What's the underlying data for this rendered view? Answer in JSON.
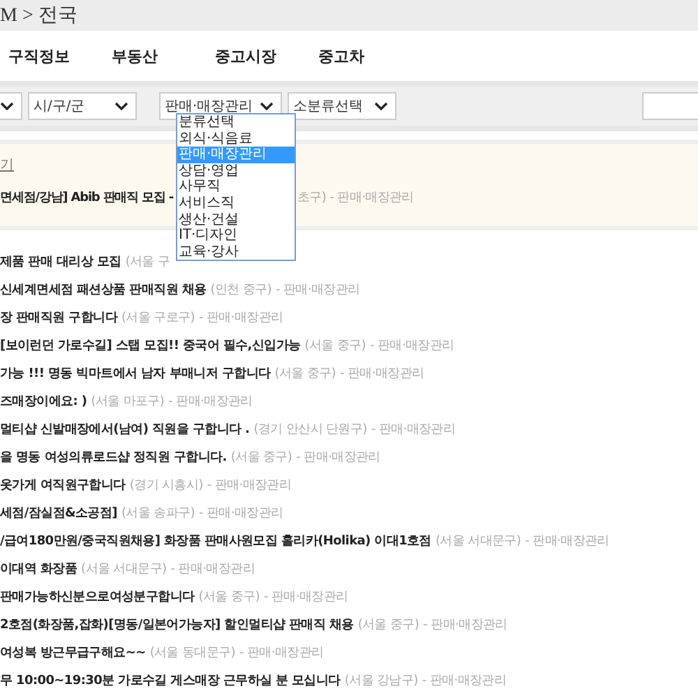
{
  "breadcrumb": "M > 전국",
  "nav": [
    "구직정보",
    "부동산",
    "중고시장",
    "중고차"
  ],
  "filters": [
    {
      "kind": "cut"
    },
    {
      "kind": "select",
      "value": "시/구/군"
    },
    {
      "kind": "select",
      "value": "판매·매장관리"
    },
    {
      "kind": "select",
      "value": "소분류선택"
    }
  ],
  "dropdown": {
    "options": [
      {
        "label": "분류선택",
        "selected": false
      },
      {
        "label": "외식·식음료",
        "selected": false
      },
      {
        "label": "판매·매장관리",
        "selected": true
      },
      {
        "label": "상담·영업",
        "selected": false
      },
      {
        "label": "사무직",
        "selected": false
      },
      {
        "label": "서비스직",
        "selected": false
      },
      {
        "label": "생산·건설",
        "selected": false
      },
      {
        "label": "IT·디자인",
        "selected": false
      },
      {
        "label": "교육·강사",
        "selected": false
      }
    ]
  },
  "featured": {
    "link": "기",
    "title": "면세점/강남] Abib 판매직 모집 -",
    "tail": "초구) - 판매·매장관리"
  },
  "posts": [
    {
      "title": "제품 판매 대리상 모집",
      "location": "(서울 구"
    },
    {
      "title": "신세계면세점 패션상품 판매직원 채용",
      "location": "(인천 중구)",
      "category": "- 판매·매장관리"
    },
    {
      "title": "장 판매직원 구합니다",
      "location": "(서울 구로구)",
      "category": "- 판매·매장관리"
    },
    {
      "title": "[보이런던 가로수길] 스탭 모집!! 중국어 필수,신입가능",
      "location": "(서울 중구)",
      "category": "- 판매·매장관리"
    },
    {
      "title": "가능 !!! 명동 빅마트에서 남자 부매니저 구합니다",
      "location": "(서울 중구)",
      "category": "- 판매·매장관리"
    },
    {
      "title": "즈매장이에요: )",
      "location": "(서울 마포구)",
      "category": "- 판매·매장관리"
    },
    {
      "title": "멀티샵 신발매장에서(남여) 직원을 구합니다 .",
      "location": "(경기 안산시 단원구)",
      "category": "- 판매·매장관리"
    },
    {
      "title": "을 명동 여성의류로드샵 정직원 구합니다.",
      "location": "(서울 중구)",
      "category": "- 판매·매장관리"
    },
    {
      "title": "옷가게 여직원구합니다",
      "location": "(경기 시흥시)",
      "category": "- 판매·매장관리"
    },
    {
      "title": "세점/잠실점&소공점]",
      "location": "(서울 송파구)",
      "category": "- 판매·매장관리"
    },
    {
      "title": "/급여180만원/중국직원채용] 화장품 판매사원모집 홀리카(Holika) 이대1호점",
      "location": "(서울 서대문구)",
      "category": "- 판매·매장관리"
    },
    {
      "title": "이대역 화장품",
      "location": "(서울 서대문구)",
      "category": "- 판매·매장관리"
    },
    {
      "title": "판매가능하신분으로여성분구합니다",
      "location": "(서울 중구)",
      "category": "- 판매·매장관리"
    },
    {
      "title": "2호점(화장품,잡화)[명동/일본어가능자] 할인멀티샵 판매직 채용",
      "location": "(서울 중구)",
      "category": "- 판매·매장관리"
    },
    {
      "title": "여성복 방근무급구해요~~",
      "location": "(서울 동대문구)",
      "category": "- 판매·매장관리"
    },
    {
      "title": "무 10:00~19:30분 가로수길 게스매장 근무하실 분 모십니다",
      "location": "(서울 강남구)",
      "category": "- 판매·매장관리"
    }
  ]
}
